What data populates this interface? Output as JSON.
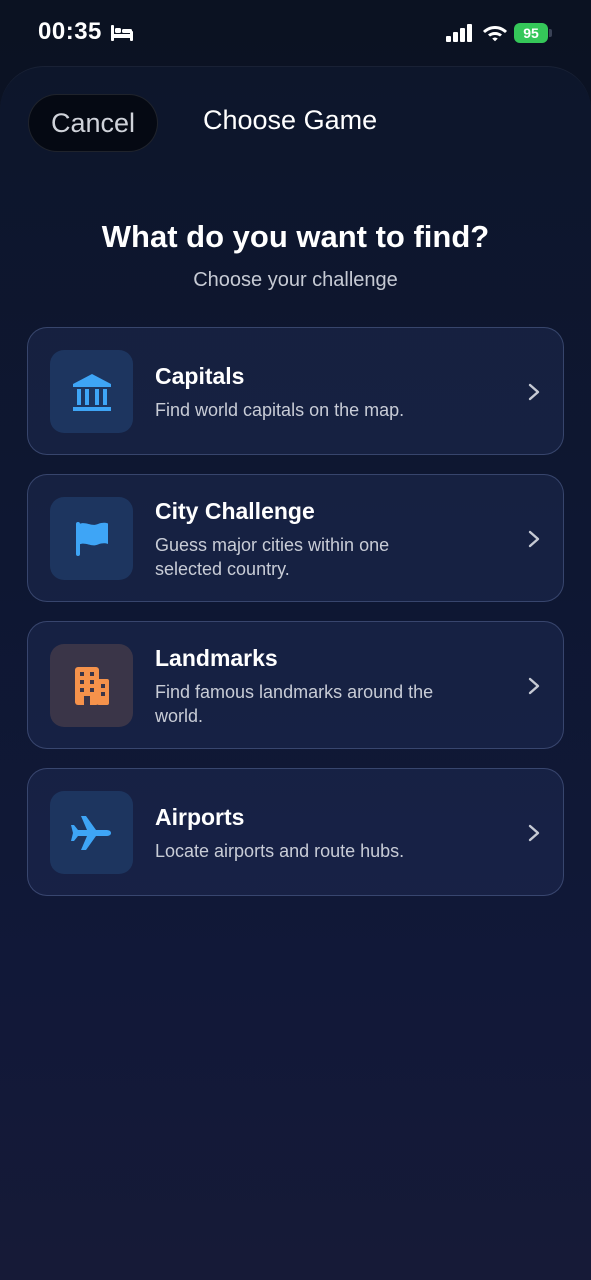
{
  "status_bar": {
    "time": "00:35",
    "battery_level": "95",
    "battery_color": "#35c759",
    "icons": [
      "bed-icon",
      "cellular-signal-icon",
      "wifi-icon",
      "battery-icon"
    ]
  },
  "nav": {
    "cancel_label": "Cancel",
    "title": "Choose Game"
  },
  "header": {
    "heading": "What do you want to find?",
    "subheading": "Choose your challenge"
  },
  "options": [
    {
      "title": "Capitals",
      "description": "Find world capitals on the map.",
      "icon": "capitol-building-icon",
      "icon_color": "#3ea5f6"
    },
    {
      "title": "City Challenge",
      "description": "Guess major cities within one selected country.",
      "icon": "flag-icon",
      "icon_color": "#3ea5f6"
    },
    {
      "title": "Landmarks",
      "description": "Find famous landmarks around the world.",
      "icon": "building-icon",
      "icon_color": "#f5924b"
    },
    {
      "title": "Airports",
      "description": "Locate airports and route hubs.",
      "icon": "airplane-icon",
      "icon_color": "#3ea5f6"
    }
  ]
}
